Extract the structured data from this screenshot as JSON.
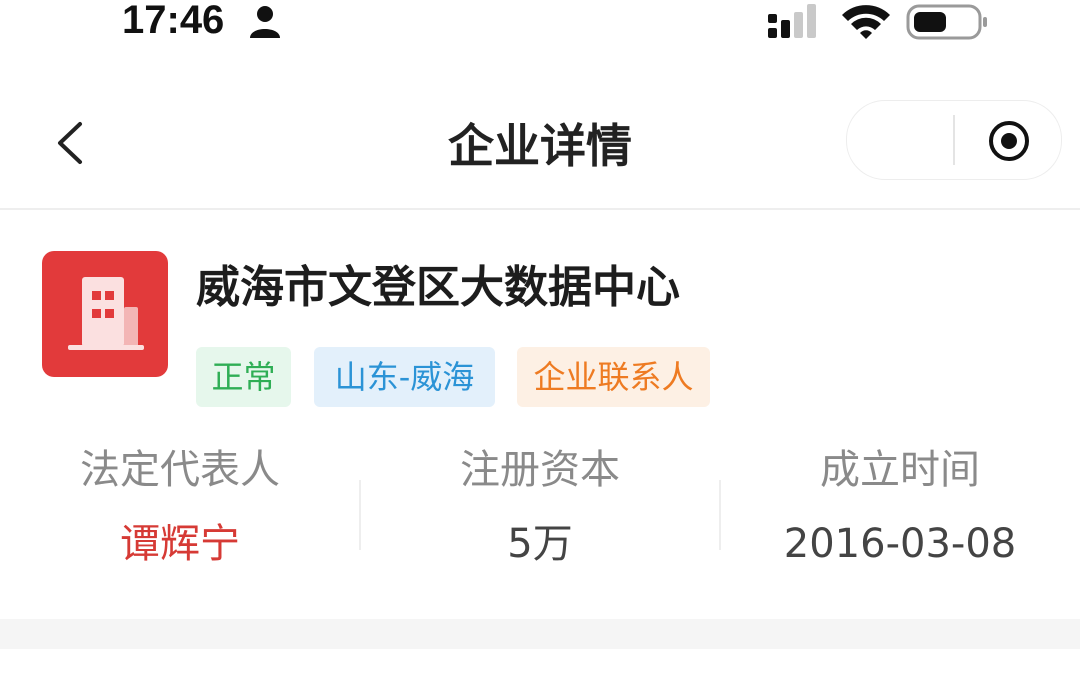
{
  "status_bar": {
    "time": "17:46",
    "icons": [
      "person-icon",
      "signal-icon",
      "wifi-icon",
      "battery-icon"
    ]
  },
  "nav": {
    "title": "企业详情",
    "back_icon": "chevron-left-icon",
    "capsule_icon": "record-icon"
  },
  "company": {
    "name": "威海市文登区大数据中心",
    "logo_icon": "building-icon",
    "logo_color": "#e23a3b",
    "tags": {
      "status": "正常",
      "region": "山东-威海",
      "contact": "企业联系人"
    }
  },
  "info": {
    "legal_rep": {
      "label": "法定代表人",
      "value": "谭辉宁"
    },
    "capital": {
      "label": "注册资本",
      "value": "5万"
    },
    "founded": {
      "label": "成立时间",
      "value": "2016-03-08"
    }
  },
  "colors": {
    "tag_status": "#2fae55",
    "tag_region": "#2b93d6",
    "tag_contact": "#ee7b22",
    "legal_rep_value": "#d63a35"
  }
}
